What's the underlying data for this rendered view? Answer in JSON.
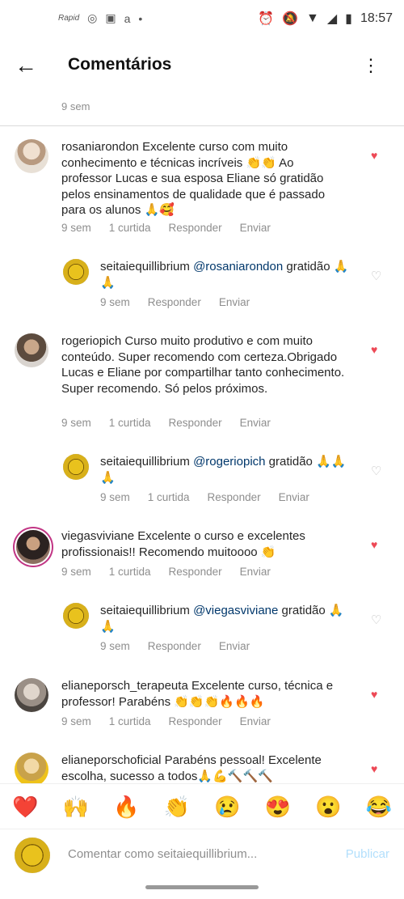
{
  "status": {
    "time": "18:57",
    "left_icons": [
      "Rapid",
      "instagram-icon",
      "app-icon",
      "amazon-icon",
      "dot"
    ]
  },
  "header": {
    "title": "Comentários"
  },
  "partial_meta": "9 sem",
  "comments": [
    {
      "user": "rosaniarondon",
      "text": "Excelente curso com muito conhecimento e técnicas incríveis 👏👏 Ao professor Lucas e sua esposa Eliane só gratidão pelos ensinamentos de qualidade que é passado para os alunos 🙏🥰",
      "time": "9 sem",
      "likes": "1 curtida",
      "reply": "Responder",
      "send": "Enviar"
    },
    {
      "user": "seitaiequillibrium",
      "mention": "@rosaniarondon",
      "text": " gratidão 🙏🙏",
      "time": "9 sem",
      "reply": "Responder",
      "send": "Enviar"
    },
    {
      "user": "rogeriopich",
      "text": "Curso muito produtivo e com muito conteúdo. Super recomendo com certeza.Obrigado Lucas e Eliane por  compartilhar tanto conhecimento.  Super recomendo. Só pelos próximos.",
      "time": "9 sem",
      "likes": "1 curtida",
      "reply": "Responder",
      "send": "Enviar"
    },
    {
      "user": "seitaiequillibrium",
      "mention": "@rogeriopich",
      "text": " gratidão 🙏🙏🙏",
      "time": "9 sem",
      "likes": "1 curtida",
      "reply": "Responder",
      "send": "Enviar"
    },
    {
      "user": "viegasviviane",
      "text": "Excelente o curso e excelentes profissionais!! Recomendo muitoooo 👏",
      "time": "9 sem",
      "likes": "1 curtida",
      "reply": "Responder",
      "send": "Enviar"
    },
    {
      "user": "seitaiequillibrium",
      "mention": "@viegasviviane",
      "text": " gratidão 🙏🙏",
      "time": "9 sem",
      "reply": "Responder",
      "send": "Enviar"
    },
    {
      "user": "elianeporsch_terapeuta",
      "text": "Excelente curso, técnica e professor! Parabéns 👏👏👏🔥🔥🔥",
      "time": "9 sem",
      "likes": "1 curtida",
      "reply": "Responder",
      "send": "Enviar"
    },
    {
      "user": "elianeporschoficial",
      "text": "Parabéns pessoal! Excelente escolha, sucesso a todos🙏💪🔨🔨🔨"
    }
  ],
  "reactions": [
    "❤️",
    "🙌",
    "🔥",
    "👏",
    "😢",
    "😍",
    "😮",
    "😂"
  ],
  "composer": {
    "placeholder": "Comentar como seitaiequillibrium...",
    "post": "Publicar"
  },
  "colors": {
    "like_red": "#ed4956",
    "mention_blue": "#00376b",
    "publish_disabled": "#b2dffc"
  }
}
